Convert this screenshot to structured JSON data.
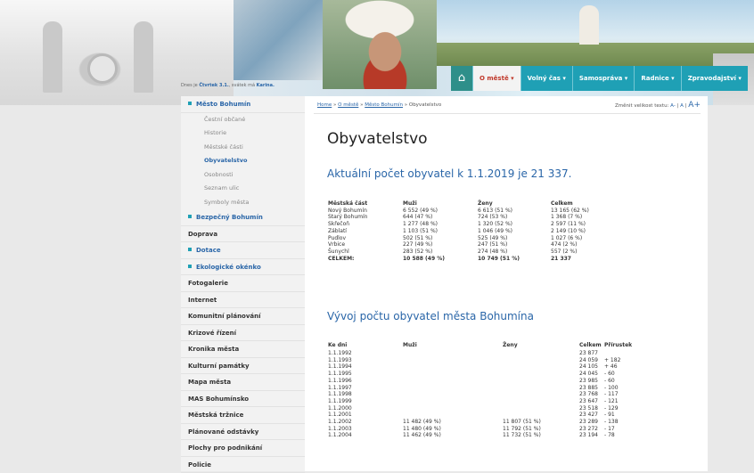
{
  "header": {
    "today_prefix": "Dnes je",
    "today_day": "Čtvrtek 3.1.",
    "today_mid": ", svátek má",
    "today_name": "Karina."
  },
  "nav": {
    "home_icon": "home-icon",
    "items": [
      "O městě ▾",
      "Volný čas ▾",
      "Samospráva ▾",
      "Radnice ▾",
      "Zpravodajství ▾"
    ],
    "active_index": 0,
    "colors": {
      "bar": "#1fa0b5",
      "home": "#2e8f8a",
      "active_text": "#c0392b"
    }
  },
  "sidebar": {
    "items": [
      {
        "label": "Město Bohumín",
        "type": "section"
      },
      {
        "label": "Čestní občané",
        "type": "sub"
      },
      {
        "label": "Historie",
        "type": "sub"
      },
      {
        "label": "Městské části",
        "type": "sub"
      },
      {
        "label": "Obyvatelstvo",
        "type": "sub",
        "current": true
      },
      {
        "label": "Osobnosti",
        "type": "sub"
      },
      {
        "label": "Seznam ulic",
        "type": "sub"
      },
      {
        "label": "Symboly města",
        "type": "sub"
      },
      {
        "label": "Bezpečný Bohumín",
        "type": "section"
      },
      {
        "label": "Doprava",
        "type": "item"
      },
      {
        "label": "Dotace",
        "type": "section"
      },
      {
        "label": "Ekologické okénko",
        "type": "section"
      },
      {
        "label": "Fotogalerie",
        "type": "item"
      },
      {
        "label": "Internet",
        "type": "item"
      },
      {
        "label": "Komunitní plánování",
        "type": "item"
      },
      {
        "label": "Krizové řízení",
        "type": "item"
      },
      {
        "label": "Kronika města",
        "type": "item"
      },
      {
        "label": "Kulturní památky",
        "type": "item"
      },
      {
        "label": "Mapa města",
        "type": "item"
      },
      {
        "label": "MAS Bohumínsko",
        "type": "item"
      },
      {
        "label": "Městská tržnice",
        "type": "item"
      },
      {
        "label": "Plánované odstávky",
        "type": "item"
      },
      {
        "label": "Plochy pro podnikání",
        "type": "item"
      },
      {
        "label": "Policie",
        "type": "item"
      }
    ]
  },
  "breadcrumb": {
    "home": "Home",
    "sep": " » ",
    "l1": "O městě",
    "l2": "Město Bohumín",
    "current": "Obyvatelstvo"
  },
  "fontsize": {
    "label": "Změnit velikost textu:",
    "small": "A-",
    "normal": "A",
    "large": "A+"
  },
  "page": {
    "title": "Obyvatelstvo",
    "summary": "Aktuální počet obyvatel k 1.1.2019 je 21 337.",
    "history_title": "Vývoj počtu obyvatel města Bohumína"
  },
  "table1": {
    "headers": [
      "Městská část",
      "Muži",
      "Ženy",
      "Celkem"
    ],
    "rows": [
      [
        "Nový Bohumín",
        "6 552  (49 %)",
        "6 613  (51 %)",
        "13 165  (62 %)"
      ],
      [
        "Starý Bohumín",
        "644  (47 %)",
        "724  (53 %)",
        "1 368  (7 %)"
      ],
      [
        "Skřečoň",
        "1 277  (48 %)",
        "1 320  (52 %)",
        "2 597  (11 %)"
      ],
      [
        "Záblatí",
        "1 103  (51 %)",
        "1 046  (49 %)",
        "2 149  (10 %)"
      ],
      [
        "Pudlov",
        "502  (51 %)",
        "525  (49 %)",
        "1 027  (6 %)"
      ],
      [
        "Vrbice",
        "227  (49 %)",
        "247  (51 %)",
        "474  (2 %)"
      ],
      [
        "Šunychl",
        "283  (52 %)",
        "274  (48 %)",
        "557  (2 %)"
      ]
    ],
    "total": [
      "CELKEM:",
      "10 588  (49 %)",
      "10 749  (51 %)",
      "21 337"
    ]
  },
  "table2": {
    "headers": [
      "Ke dni",
      "Muži",
      "Ženy",
      "Celkem",
      "Přírustek"
    ],
    "rows": [
      [
        "1.1.1992",
        "",
        "",
        "23 877",
        ""
      ],
      [
        "1.1.1993",
        "",
        "",
        "24 059",
        "+ 182"
      ],
      [
        "1.1.1994",
        "",
        "",
        "24 105",
        "+ 46"
      ],
      [
        "1.1.1995",
        "",
        "",
        "24 045",
        "- 60"
      ],
      [
        "1.1.1996",
        "",
        "",
        "23 985",
        "- 60"
      ],
      [
        "1.1.1997",
        "",
        "",
        "23 885",
        "- 100"
      ],
      [
        "1.1.1998",
        "",
        "",
        "23 768",
        "- 117"
      ],
      [
        "1.1.1999",
        "",
        "",
        "23 647",
        "- 121"
      ],
      [
        "1.1.2000",
        "",
        "",
        "23 518",
        "- 129"
      ],
      [
        "1.1.2001",
        "",
        "",
        "23 427",
        "- 91"
      ],
      [
        "1.1.2002",
        "11 482 (49 %)",
        "11 807  (51 %)",
        "23 289",
        "- 138"
      ],
      [
        "1.1.2003",
        "11 480 (49 %)",
        "11 792  (51 %)",
        "23 272",
        "- 17"
      ],
      [
        "1.1.2004",
        "11 462 (49 %)",
        "11 732  (51 %)",
        "23 194",
        "- 78"
      ]
    ]
  }
}
